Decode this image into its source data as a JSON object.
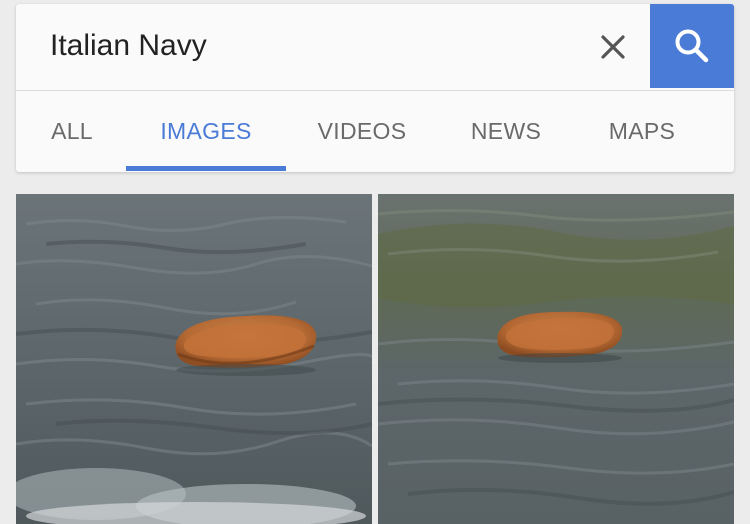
{
  "search": {
    "query": "Italian Navy",
    "clear_icon": "close-icon",
    "search_icon": "search-icon"
  },
  "tabs": [
    {
      "label": "ALL",
      "active": false
    },
    {
      "label": "IMAGES",
      "active": true
    },
    {
      "label": "VIDEOS",
      "active": false
    },
    {
      "label": "NEWS",
      "active": false
    },
    {
      "label": "MAPS",
      "active": false
    }
  ],
  "results": [
    {
      "subject": "pizza floating in water"
    },
    {
      "subject": "pizza floating in water"
    }
  ],
  "colors": {
    "accent": "#4a7bd6",
    "tab_inactive": "#6a6a6a",
    "water": "#5f6a6e"
  }
}
